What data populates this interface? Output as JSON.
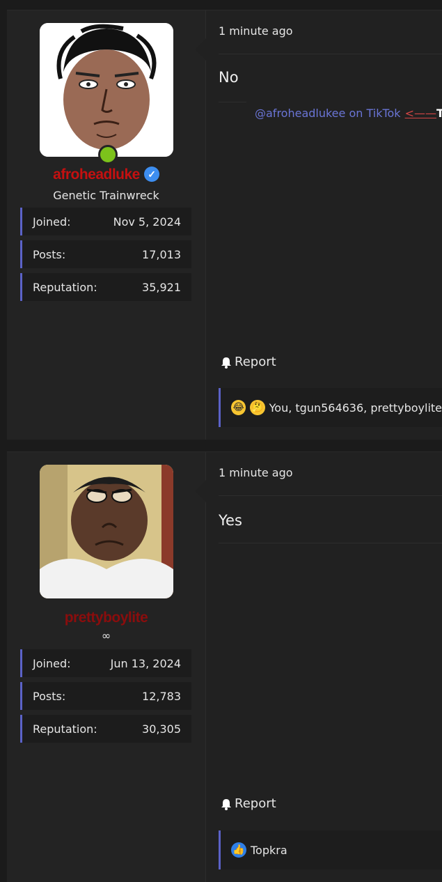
{
  "posts": [
    {
      "user": {
        "name": "afroheadluke",
        "title": "Genetic Trainwreck",
        "stats": [
          {
            "label": "Joined:",
            "value": "Nov 5, 2024"
          },
          {
            "label": "Posts:",
            "value": "17,013"
          },
          {
            "label": "Reputation:",
            "value": "35,921"
          }
        ]
      },
      "time": "1 minute ago",
      "message": "No",
      "signature": {
        "link": "@afroheadlukee on TikTok",
        "arrow": "<——",
        "trail": "Th"
      },
      "report": "Report",
      "reactions": "You, tgun564636, prettyboylite"
    },
    {
      "user": {
        "name": "prettyboylite",
        "title": "∞",
        "stats": [
          {
            "label": "Joined:",
            "value": "Jun 13, 2024"
          },
          {
            "label": "Posts:",
            "value": "12,783"
          },
          {
            "label": "Reputation:",
            "value": "30,305"
          }
        ]
      },
      "time": "1 minute ago",
      "message": "Yes",
      "report": "Report",
      "reactions": "Topkra"
    }
  ],
  "colors": {
    "username": "#c51010",
    "accent": "#5b62c7",
    "online": "#7cc21b",
    "link": "#6a75d6"
  }
}
